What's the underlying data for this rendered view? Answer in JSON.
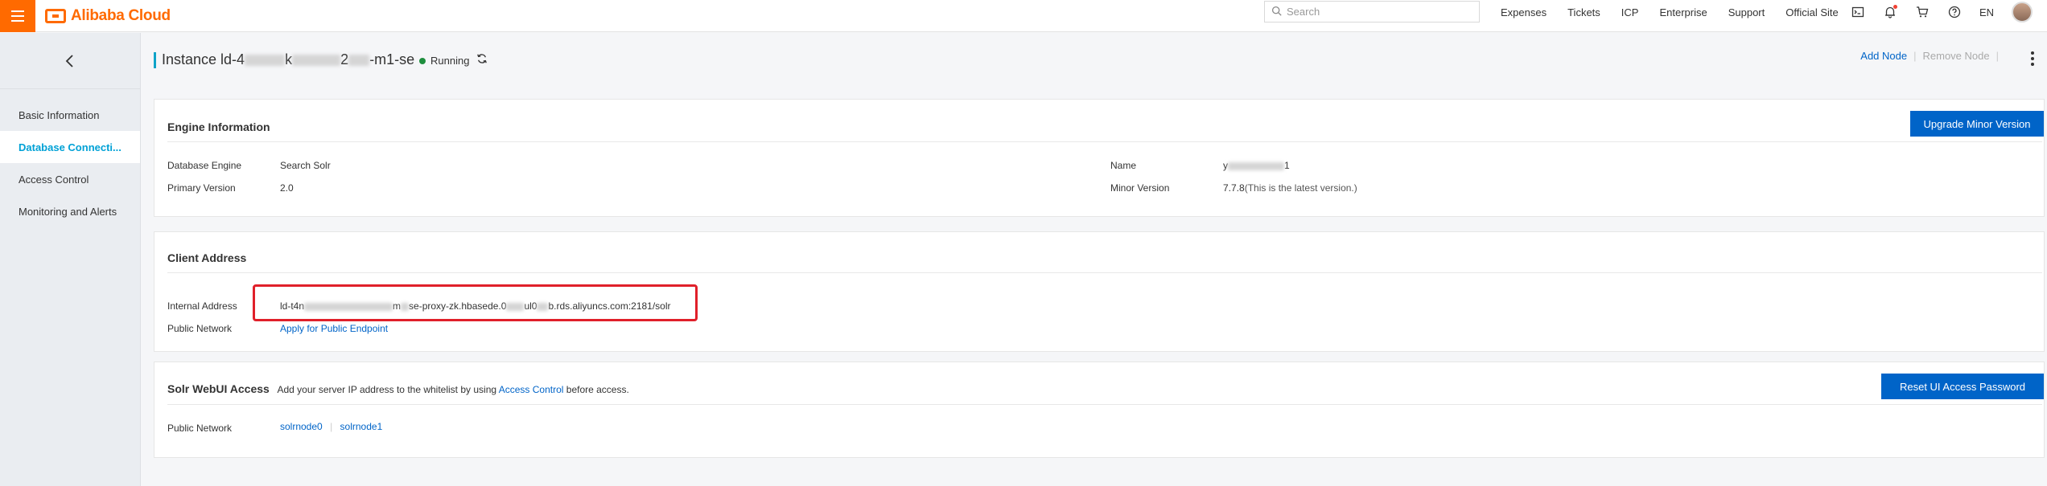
{
  "header": {
    "brand": "Alibaba Cloud",
    "search_placeholder": "Search",
    "links": [
      "Expenses",
      "Tickets",
      "ICP",
      "Enterprise",
      "Support",
      "Official Site"
    ],
    "lang": "EN",
    "icons": [
      "terminal-icon",
      "bell-icon",
      "cart-icon",
      "help-icon"
    ]
  },
  "sidebar": {
    "items": [
      {
        "label": "Basic Information",
        "active": false
      },
      {
        "label": "Database Connecti...",
        "active": true
      },
      {
        "label": "Access Control",
        "active": false
      },
      {
        "label": "Monitoring and Alerts",
        "active": false
      }
    ]
  },
  "instance": {
    "title_prefix": "Instance ld-4",
    "title_mid": "k",
    "title_mid2": "2",
    "title_suffix": "-m1-se",
    "status": "Running",
    "add_node": "Add Node",
    "remove_node": "Remove Node"
  },
  "engine": {
    "title": "Engine Information",
    "upgrade_button": "Upgrade Minor Version",
    "db_engine_label": "Database Engine",
    "db_engine_value": "Search Solr",
    "primary_version_label": "Primary Version",
    "primary_version_value": "2.0",
    "name_label": "Name",
    "name_value_start": "y",
    "name_value_end": "1",
    "minor_version_label": "Minor Version",
    "minor_version_value": "7.7.8",
    "minor_version_note": "(This is the latest version.)"
  },
  "client": {
    "title": "Client Address",
    "internal_label": "Internal Address",
    "internal_value_a": "ld-t4n",
    "internal_value_b": "m",
    "internal_value_c": "se-proxy-zk.hbasede.0",
    "internal_value_d": "ul0",
    "internal_value_e": "b.rds.aliyuncs.com:2181/solr",
    "public_label": "Public Network",
    "public_link": "Apply for Public Endpoint"
  },
  "webui": {
    "title": "Solr WebUI Access",
    "desc_before": "Add your server IP address to the whitelist by using",
    "desc_link": "Access Control",
    "desc_after": "before access.",
    "reset_button": "Reset UI Access Password",
    "public_label": "Public Network",
    "node0": "solrnode0",
    "node1": "solrnode1"
  },
  "colors": {
    "brand_orange": "#ff6a00",
    "primary_blue": "#0064c8",
    "accent_teal": "#00a1d6",
    "running_green": "#1e8e3e",
    "highlight_red": "#e0202a"
  }
}
